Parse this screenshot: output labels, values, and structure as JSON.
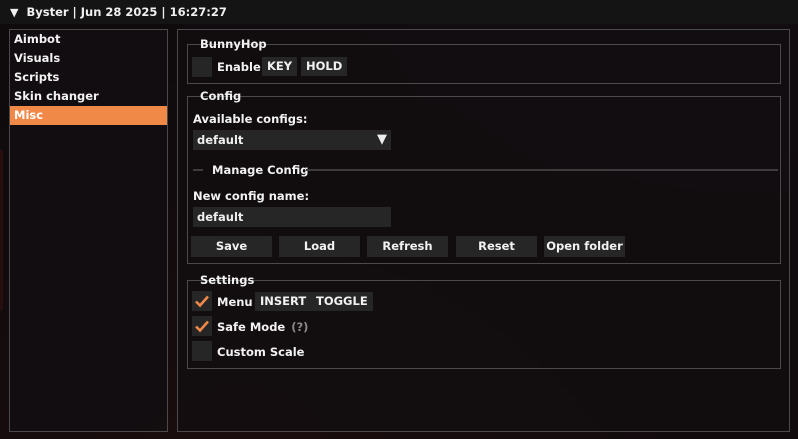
{
  "titlebar": {
    "collapse_icon": "triangle-down-icon",
    "title": "Byster | Jun 28 2025 | 16:27:27"
  },
  "sidebar": {
    "items": [
      {
        "label": "Aimbot"
      },
      {
        "label": "Visuals"
      },
      {
        "label": "Scripts"
      },
      {
        "label": "Skin changer"
      },
      {
        "label": "Misc",
        "active": true
      }
    ]
  },
  "bunnyhop": {
    "title": "BunnyHop",
    "enable_label": "Enable",
    "enabled": false,
    "key": "KEY",
    "mode": "HOLD"
  },
  "config": {
    "title": "Config",
    "available_label": "Available configs:",
    "selected": "default",
    "manage_label": "Manage Config",
    "new_name_label": "New config name:",
    "new_name_value": "default",
    "buttons": {
      "save": "Save",
      "load": "Load",
      "refresh": "Refresh",
      "reset": "Reset",
      "open_folder": "Open folder"
    }
  },
  "settings": {
    "title": "Settings",
    "menu_label": "Menu",
    "menu_checked": true,
    "menu_key": "INSERT",
    "menu_mode": "TOGGLE",
    "safe_mode_label": "Safe Mode",
    "safe_mode_checked": true,
    "safe_mode_hint": "(?)",
    "custom_scale_label": "Custom Scale",
    "custom_scale_checked": false
  },
  "colors": {
    "accent": "#f08848",
    "panel": "#262626",
    "border": "#4a4a4a",
    "text": "#f2f2f2"
  }
}
